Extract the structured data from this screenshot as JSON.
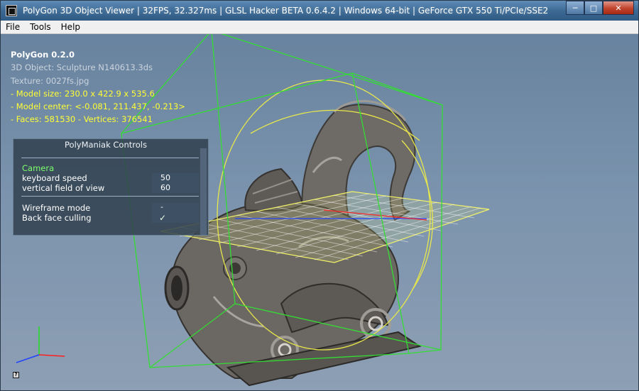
{
  "window": {
    "title": "PolyGon 3D Object Viewer | 32FPS, 32.327ms | GLSL Hacker BETA 0.6.4.2 | Windows 64-bit | GeForce GTX 550 Ti/PCIe/SSE2",
    "controls": {
      "minimize": "─",
      "maximize": "□",
      "close": "✕"
    }
  },
  "menu": {
    "file": "File",
    "tools": "Tools",
    "help": "Help"
  },
  "info": {
    "app_version": "PolyGon 0.2.0",
    "object": "3D Object: Sculpture N140613.3ds",
    "texture": "Texture: 0027fs.jpg",
    "model_size": "- Model size:  230.0 x 422.9 x 535.6",
    "model_center": "- Model center:  <-0.081, 211.437, -0.213>",
    "faces_vertices": "- Faces: 581530 - Vertices: 376541"
  },
  "panel": {
    "title": "PolyManiak Controls",
    "camera_section": "Camera",
    "keyboard_speed_label": "keyboard speed",
    "keyboard_speed_value": "50",
    "fov_label": "vertical field of view",
    "fov_value": "60",
    "wireframe_label": "Wireframe mode",
    "wireframe_value": "-",
    "backface_label": "Back face culling",
    "backface_check": "✓"
  },
  "help_icon": "?",
  "colors": {
    "bounding_box": "#33dd33",
    "gizmo_rings": "#e8e84a",
    "grid": "#ffffff",
    "ground_plane": "#f2f268",
    "axis_x": "#ff2020",
    "axis_y": "#20e020",
    "axis_z": "#2040ff"
  },
  "icons": {
    "app": "polygon-app-icon",
    "help": "help-icon",
    "check": "checkmark-icon",
    "axes": "xyz-axes-gizmo-icon"
  }
}
